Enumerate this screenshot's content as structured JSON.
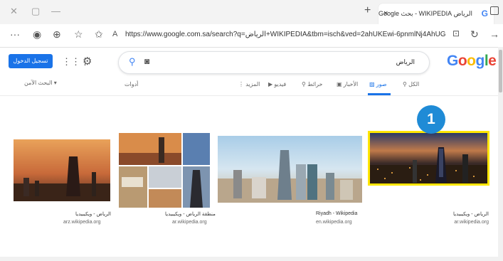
{
  "browser": {
    "tab_title": "الرياض WIKIPEDIA - بحث Google",
    "url": "https://www.google.com.sa/search?q=الرياض+WIKIPEDIA&tbm=isch&ved=2ahUKEwi-6pnmlNj4AhUGohoKHXz...",
    "new_tab": "+",
    "close_tab": "×",
    "more": "···"
  },
  "google": {
    "logo": "Google",
    "search_query": "الرياض",
    "signin_label": "تسجيل الدخول",
    "safesearch_label": "البحث الآمن ▾",
    "tools_label": "أدوات",
    "tabs": {
      "all": "الكل",
      "images": "صور",
      "news": "الأخبار",
      "maps": "خرائط",
      "videos": "فيديو",
      "more": "المزيد"
    },
    "logo_colors": [
      "#4285f4",
      "#ea4335",
      "#fbbc05",
      "#4285f4",
      "#34a853",
      "#ea4335"
    ]
  },
  "results": [
    {
      "caption": "الرياض - ويكيبيديا",
      "domain": "ar.wikipedia.org"
    },
    {
      "caption": "Riyadh - Wikipedia",
      "domain": "en.wikipedia.org"
    },
    {
      "caption": "منطقة الرياض - ويكيبيديا",
      "domain": "ar.wikipedia.org"
    },
    {
      "caption": "الرياض - ويكيبيديا",
      "domain": "arz.wikipedia.org"
    }
  ],
  "annotation": {
    "badge": "1",
    "highlight_color": "#ffe600"
  }
}
